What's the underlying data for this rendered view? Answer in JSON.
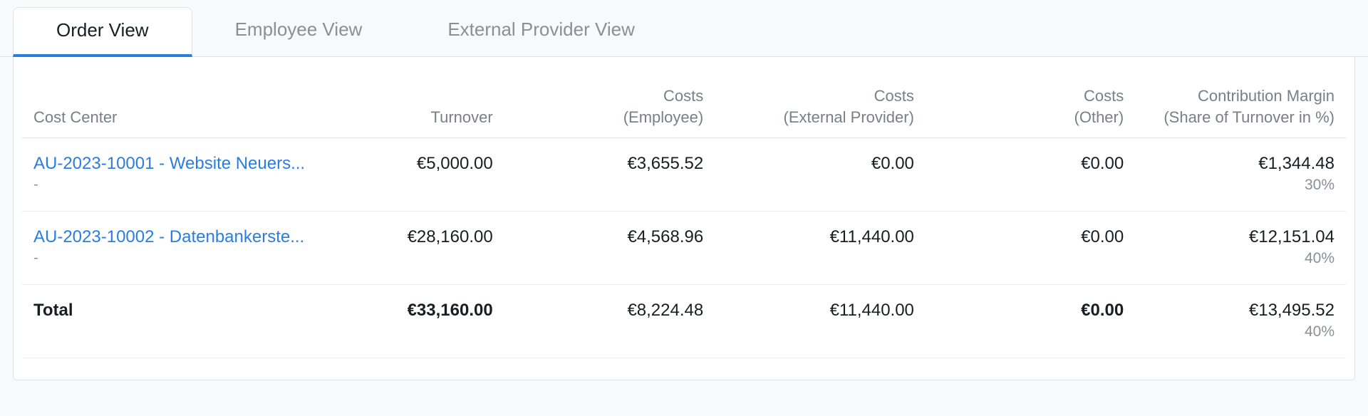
{
  "tabs": [
    {
      "label": "Order View",
      "active": true
    },
    {
      "label": "Employee View",
      "active": false
    },
    {
      "label": "External Provider View",
      "active": false
    }
  ],
  "headers": {
    "cost_center": "Cost Center",
    "turnover": "Turnover",
    "costs_employee_l1": "Costs",
    "costs_employee_l2": "(Employee)",
    "costs_external_l1": "Costs",
    "costs_external_l2": "(External Provider)",
    "costs_other_l1": "Costs",
    "costs_other_l2": "(Other)",
    "margin_l1": "Contribution Margin",
    "margin_l2": "(Share of Turnover in %)"
  },
  "rows": [
    {
      "cost_center": "AU-2023-10001 - Website Neuers...",
      "sub": "-",
      "turnover": "€5,000.00",
      "costs_employee": "€3,655.52",
      "costs_external": "€0.00",
      "costs_other": "€0.00",
      "margin": "€1,344.48",
      "margin_pct": "30%"
    },
    {
      "cost_center": "AU-2023-10002 - Datenbankerste...",
      "sub": "-",
      "turnover": "€28,160.00",
      "costs_employee": "€4,568.96",
      "costs_external": "€11,440.00",
      "costs_other": "€0.00",
      "margin": "€12,151.04",
      "margin_pct": "40%"
    }
  ],
  "total": {
    "label": "Total",
    "turnover": "€33,160.00",
    "costs_employee": "€8,224.48",
    "costs_external": "€11,440.00",
    "costs_other": "€0.00",
    "margin": "€13,495.52",
    "margin_pct": "40%"
  }
}
